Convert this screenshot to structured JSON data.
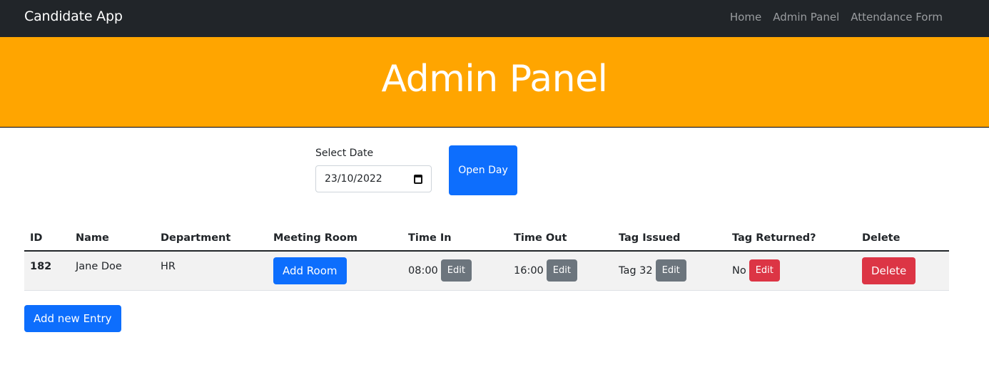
{
  "navbar": {
    "brand": "Candidate App",
    "links": [
      "Home",
      "Admin Panel",
      "Attendance Form"
    ]
  },
  "hero": {
    "title": "Admin Panel"
  },
  "date_picker": {
    "label": "Select Date",
    "value": "23/10/2022",
    "icon": "calendar-icon"
  },
  "open_day_label": "Open Day",
  "table": {
    "headers": [
      "ID",
      "Name",
      "Department",
      "Meeting Room",
      "Time In",
      "Time Out",
      "Tag Issued",
      "Tag Returned?",
      "Delete"
    ],
    "rows": [
      {
        "id": "182",
        "name": "Jane Doe",
        "department": "HR",
        "meeting_room_button": "Add Room",
        "time_in": "08:00",
        "time_out": "16:00",
        "tag_issued": "Tag 32",
        "tag_returned": "No",
        "edit_label": "Edit",
        "delete_label": "Delete"
      }
    ]
  },
  "add_entry_label": "Add new Entry",
  "colors": {
    "navbar": "#212529",
    "hero": "#ffa500",
    "primary": "#0d6efd",
    "secondary": "#6c757d",
    "danger": "#dc3545"
  }
}
